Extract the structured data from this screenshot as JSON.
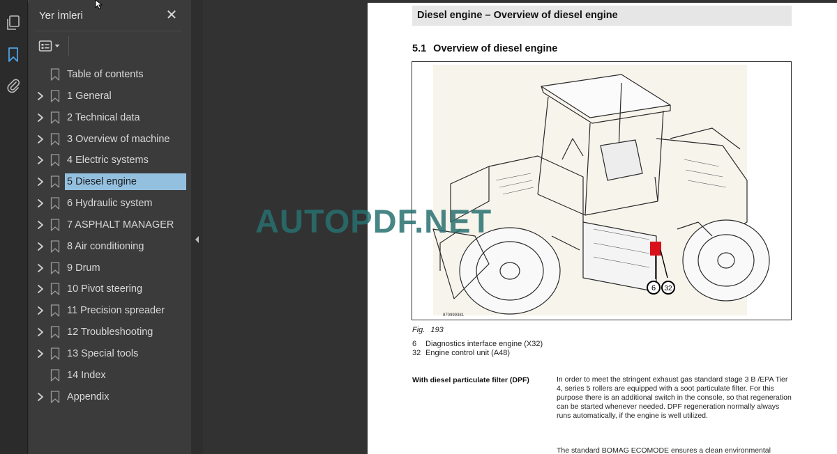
{
  "panel": {
    "title": "Yer İmleri",
    "close_glyph": "✕",
    "options_icon": "bookmark-options-icon"
  },
  "rail": {
    "icons": [
      "pages-icon",
      "bookmark-icon",
      "attachment-icon"
    ],
    "active": "bookmark-icon"
  },
  "bookmarks": [
    {
      "label": "Table of contents",
      "expandable": false
    },
    {
      "label": "1 General",
      "expandable": true
    },
    {
      "label": "2 Technical data",
      "expandable": true
    },
    {
      "label": "3 Overview of machine",
      "expandable": true
    },
    {
      "label": "4 Electric systems",
      "expandable": true
    },
    {
      "label": "5 Diesel engine",
      "expandable": true,
      "selected": true
    },
    {
      "label": "6 Hydraulic system",
      "expandable": true
    },
    {
      "label": "7 ASPHALT MANAGER",
      "expandable": true
    },
    {
      "label": "8 Air conditioning",
      "expandable": true
    },
    {
      "label": "9 Drum",
      "expandable": true
    },
    {
      "label": "10 Pivot steering",
      "expandable": true
    },
    {
      "label": "11 Precision spreader",
      "expandable": true
    },
    {
      "label": "12 Troubleshooting",
      "expandable": true
    },
    {
      "label": "13 Special tools",
      "expandable": true
    },
    {
      "label": "14 Index",
      "expandable": false
    },
    {
      "label": "Appendix",
      "expandable": true
    }
  ],
  "document": {
    "header": "Diesel engine – Overview of diesel engine",
    "section_number": "5.1",
    "section_title": "Overview of diesel engine",
    "figure": {
      "code": "870999381",
      "callouts": [
        "6",
        "32"
      ]
    },
    "fig_label": "Fig.",
    "fig_number": "193",
    "legend": [
      {
        "key": "6",
        "text": "Diagnostics interface engine (X32)"
      },
      {
        "key": "32",
        "text": "Engine control unit (A48)"
      }
    ],
    "dpf_label": "With diesel particulate filter (DPF)",
    "dpf_text": "In order to meet the stringent exhaust gas standard stage 3 B /EPA Tier 4, series 5 rollers are equipped with a soot particulate filter. For this purpose there is an additional switch in the console, so that regeneration can be started whenever needed. DPF regeneration normally always runs automatically, if the engine is well utilized.",
    "eco_text": "The standard BOMAG ECOMODE ensures a clean environmental"
  },
  "watermark": "AUTOPDF.NET",
  "colors": {
    "selected_bg": "#94c0e0",
    "panel_bg": "#3b3b3b",
    "active_icon": "#4da3e8",
    "callout_red": "#d8111b"
  }
}
